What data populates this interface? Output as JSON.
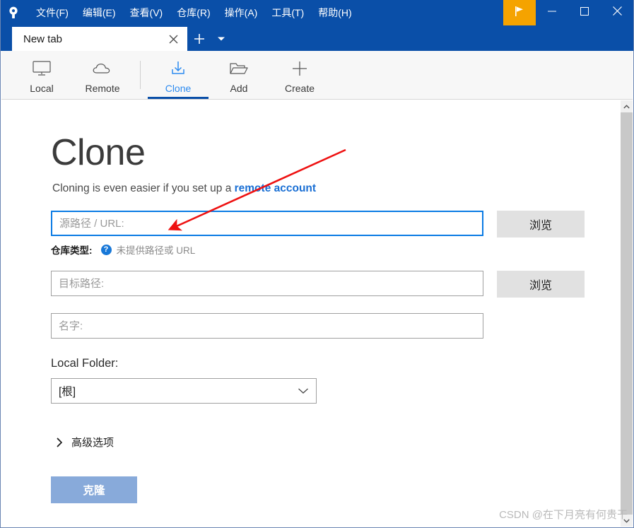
{
  "window": {
    "logo_icon": "sourcetree-logo-icon",
    "menus": [
      {
        "label": "文件(F)",
        "name": "menu-file"
      },
      {
        "label": "编辑(E)",
        "name": "menu-edit"
      },
      {
        "label": "查看(V)",
        "name": "menu-view"
      },
      {
        "label": "仓库(R)",
        "name": "menu-repository"
      },
      {
        "label": "操作(A)",
        "name": "menu-actions"
      },
      {
        "label": "工具(T)",
        "name": "menu-tools"
      },
      {
        "label": "帮助(H)",
        "name": "menu-help"
      }
    ],
    "flag_button_color": "#f5a300",
    "titlebar_color": "#0a4fa8",
    "controls": {
      "minimize": "—",
      "maximize": "▢",
      "close": "✕"
    }
  },
  "tabs": {
    "items": [
      {
        "label": "New tab",
        "active": true
      }
    ],
    "new_tab_glyph": "+",
    "tab_menu_glyph": "▾",
    "close_glyph": "✕"
  },
  "toolbar": {
    "items": [
      {
        "label": "Local",
        "icon": "monitor-icon",
        "active": false
      },
      {
        "label": "Remote",
        "icon": "cloud-icon",
        "active": false
      },
      {
        "label": "Clone",
        "icon": "clone-download-icon",
        "active": true
      },
      {
        "label": "Add",
        "icon": "folder-open-icon",
        "active": false
      },
      {
        "label": "Create",
        "icon": "plus-icon",
        "active": false
      }
    ],
    "active_color": "#2d8bf0",
    "underline_color": "#0a4fa8"
  },
  "main": {
    "title": "Clone",
    "subtitle_prefix": "Cloning is even easier if you set up a ",
    "subtitle_link": "remote account",
    "source": {
      "placeholder": "源路径 / URL:",
      "value": "",
      "browse_label": "浏览",
      "focused": true
    },
    "repo_type": {
      "label": "仓库类型:",
      "help_glyph": "?",
      "value": "未提供路径或 URL"
    },
    "destination": {
      "placeholder": "目标路径:",
      "value": "",
      "browse_label": "浏览"
    },
    "name": {
      "placeholder": "名字:",
      "value": ""
    },
    "local_folder": {
      "label": "Local Folder:",
      "selected": "[根]",
      "chevron": "⌄"
    },
    "advanced": {
      "chevron": "❯",
      "label": "高级选项"
    },
    "clone_button": {
      "label": "克隆",
      "color": "#88aada"
    }
  },
  "annotation": {
    "color": "#ee1111",
    "description": "red-arrow-pointing-to-source-url-field"
  },
  "scrollbar": {
    "up_glyph": "⌃",
    "down_glyph": "⌄"
  },
  "watermark": {
    "text": "CSDN @在下月亮有何贵干"
  }
}
